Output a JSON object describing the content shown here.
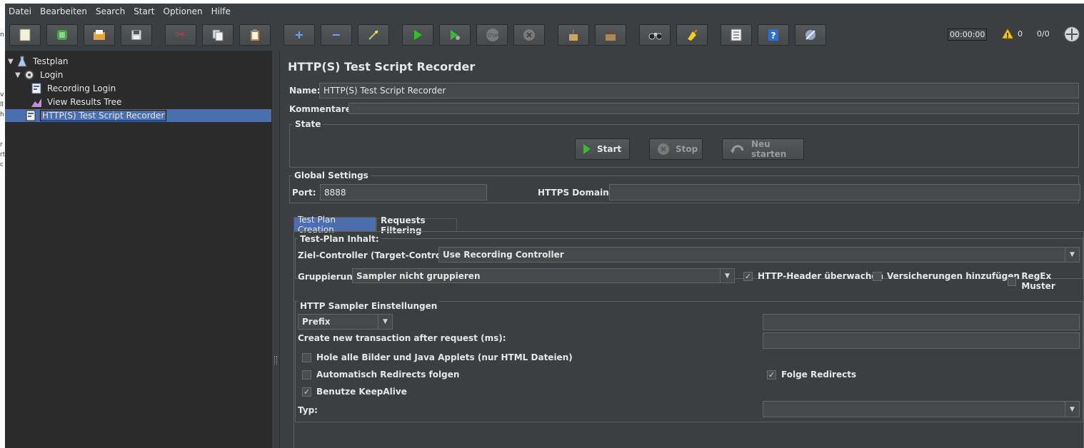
{
  "menu": [
    "Datei",
    "Bearbeiten",
    "Search",
    "Start",
    "Optionen",
    "Hilfe"
  ],
  "status": {
    "timer": "00:00:00",
    "warnings": "0",
    "threads": "0/0"
  },
  "tree": {
    "items": [
      {
        "label": "Testplan"
      },
      {
        "label": "Login"
      },
      {
        "label": "Recording Login"
      },
      {
        "label": "View Results Tree"
      },
      {
        "label": "HTTP(S) Test Script Recorder"
      }
    ]
  },
  "panel": {
    "title": "HTTP(S) Test Script Recorder",
    "name_label": "Name:",
    "name_value": "HTTP(S) Test Script Recorder",
    "comments_label": "Kommentare:",
    "state": {
      "title": "State",
      "start": "Start",
      "stop": "Stop",
      "restart": "Neu starten"
    },
    "global": {
      "title": "Global Settings",
      "port_label": "Port:",
      "port_value": "8888",
      "https_label": "HTTPS Domains:",
      "https_value": ""
    },
    "tabs": [
      "Test Plan Creation",
      "Requests Filtering"
    ],
    "plan": {
      "title": "Test-Plan Inhalt:",
      "target_label": "Ziel-Controller (Target-Controller):",
      "target_value": "Use Recording Controller",
      "grouping_label": "Gruppierung",
      "grouping_value": "Sampler nicht gruppieren",
      "cb_headers": "HTTP-Header überwachen",
      "cb_assertions": "Versicherungen hinzufügen",
      "cb_regex": "RegEx Muster"
    },
    "sampler": {
      "title": "HTTP Sampler Einstellungen",
      "prefix_value": "Prefix",
      "prefix_field": "",
      "transaction_label": "Create new transaction after request (ms):",
      "transaction_value": "",
      "cb_images": "Hole alle Bilder und Java Applets (nur HTML Dateien)",
      "cb_auto_redirects": "Automatisch Redirects folgen",
      "cb_follow_redirects": "Folge Redirects",
      "cb_keepalive": "Benutze KeepAlive",
      "type_label": "Typ:",
      "type_value": ""
    }
  },
  "checked": {
    "cb_headers": true,
    "cb_assertions": false,
    "cb_regex": false,
    "cb_images": false,
    "cb_auto_redirects": false,
    "cb_follow_redirects": true,
    "cb_keepalive": true
  },
  "colors": {
    "background": "#3c3f41",
    "tree": "#2b2b2b",
    "selection": "#4b6eaf",
    "text": "#e6e6e6"
  }
}
